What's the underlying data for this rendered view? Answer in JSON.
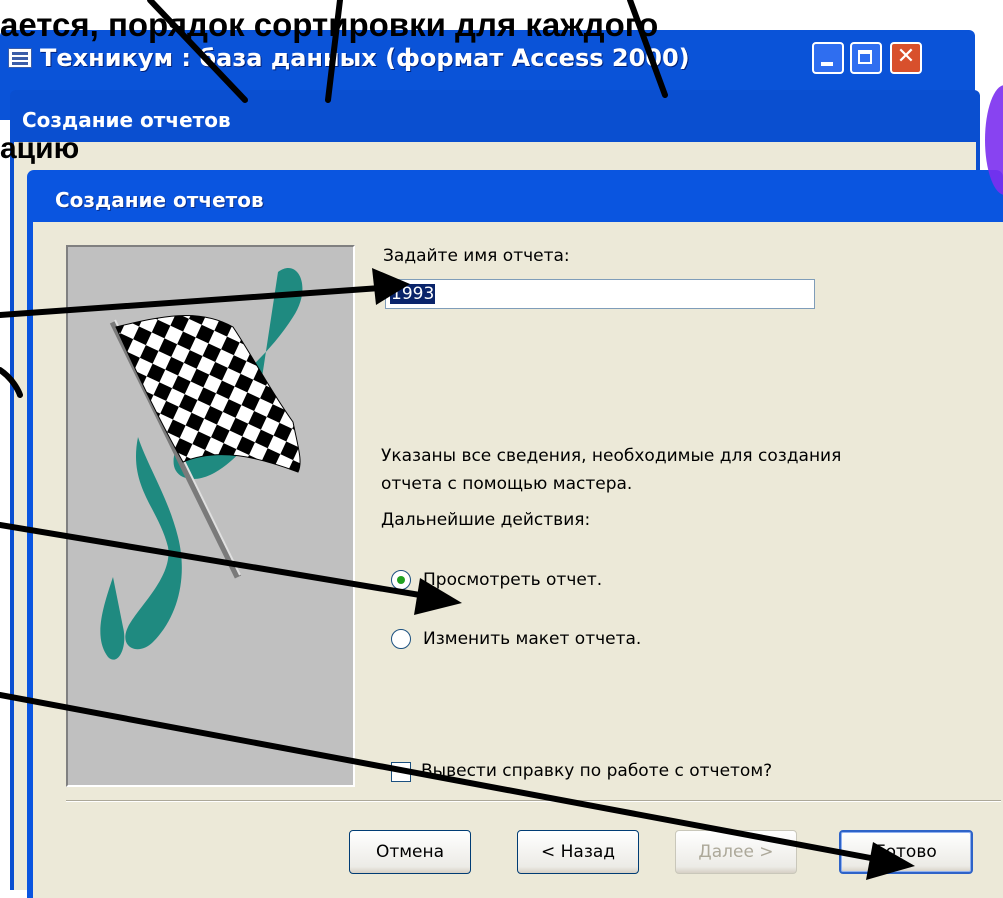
{
  "slide": {
    "overlay_top": "ается, порядок сортировки для каждого",
    "overlay_left": "ацию"
  },
  "back_window": {
    "title": "Техникум : база данных (формат Access 2000)"
  },
  "middle_window": {
    "title": "Создание отчетов"
  },
  "dialog": {
    "title": "Создание отчетов",
    "report_name_label": "Задайте имя отчета:",
    "report_name_value": "1993",
    "info_line1": "Указаны все сведения, необходимые для создания",
    "info_line2": "отчета с помощью мастера.",
    "next_actions_label": "Дальнейшие действия:",
    "options": [
      {
        "label": "Просмотреть отчет.",
        "checked": true
      },
      {
        "label": "Изменить макет отчета.",
        "checked": false
      }
    ],
    "help_checkbox_label": "Вывести справку по работе с отчетом?",
    "buttons": {
      "cancel": "Отмена",
      "back": "< Назад",
      "next": "Далее >",
      "finish": "Готово"
    }
  },
  "colors": {
    "title_bar": "#0a55e0",
    "dialog_bg": "#ece9d8",
    "arrow": "#000000"
  }
}
